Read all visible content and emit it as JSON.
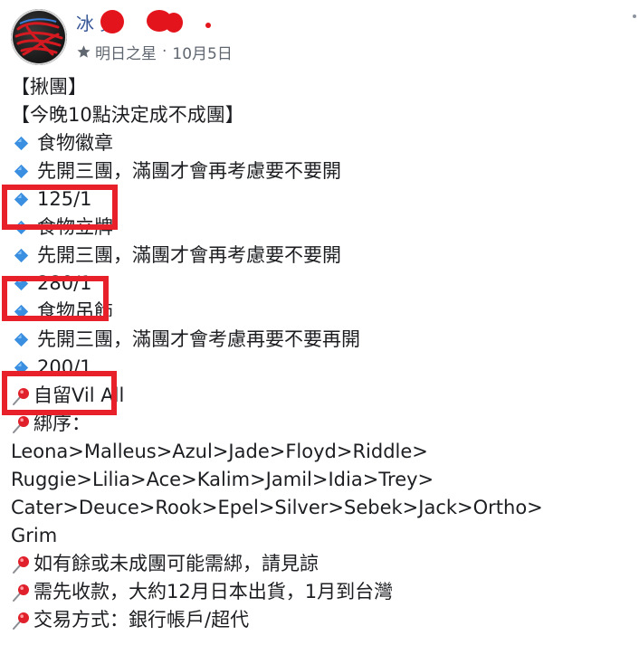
{
  "post": {
    "author": {
      "name_visible": "冰 男"
    },
    "meta": {
      "badge_label": "明日之星",
      "separator": "·",
      "time": "10月5日"
    },
    "lines": [
      {
        "kind": "plain",
        "text": "【揪團】"
      },
      {
        "kind": "plain",
        "text": "【今晚10點決定成不成團】"
      },
      {
        "kind": "diamond",
        "text": "食物徽章"
      },
      {
        "kind": "diamond",
        "text": "先開三團，滿團才會再考慮要不要開"
      },
      {
        "kind": "diamond",
        "text": "125/1"
      },
      {
        "kind": "diamond",
        "text": "食物立牌"
      },
      {
        "kind": "diamond",
        "text": "先開三團，滿團才會再考慮要不要開"
      },
      {
        "kind": "diamond",
        "text": "280/1"
      },
      {
        "kind": "diamond",
        "text": "食物吊飾"
      },
      {
        "kind": "diamond",
        "text": "先開三團，滿團才會考慮再要不要再開"
      },
      {
        "kind": "diamond",
        "text": "200/1"
      },
      {
        "kind": "pin",
        "text": "自留Vil All"
      },
      {
        "kind": "pin",
        "text": "綁序："
      },
      {
        "kind": "plain",
        "text": "Leona>Malleus>Azul>Jade>Floyd>Riddle>"
      },
      {
        "kind": "plain",
        "text": "Ruggie>Lilia>Ace>Kalim>Jamil>Idia>Trey>"
      },
      {
        "kind": "plain",
        "text": "Cater>Deuce>Rook>Epel>Silver>Sebek>Jack>Ortho>"
      },
      {
        "kind": "plain",
        "text": "Grim"
      },
      {
        "kind": "pin",
        "text": "如有餘或未成團可能需綁，請見諒"
      },
      {
        "kind": "pin",
        "text": "需先收款，大約12月日本出貨，1月到台灣"
      },
      {
        "kind": "pin",
        "text": "交易方式：銀行帳戶/超代"
      }
    ]
  },
  "colors": {
    "name_blue": "#385898",
    "meta_gray": "#606770",
    "highlight_red": "#e8202a",
    "diamond_blue": "#3b8fe0",
    "pin_red": "#e0202a"
  },
  "icons": {
    "badge": "star-badge-icon",
    "diamond": "blue-diamond-icon",
    "pin": "round-pushpin-icon",
    "more": "more-options-icon"
  }
}
